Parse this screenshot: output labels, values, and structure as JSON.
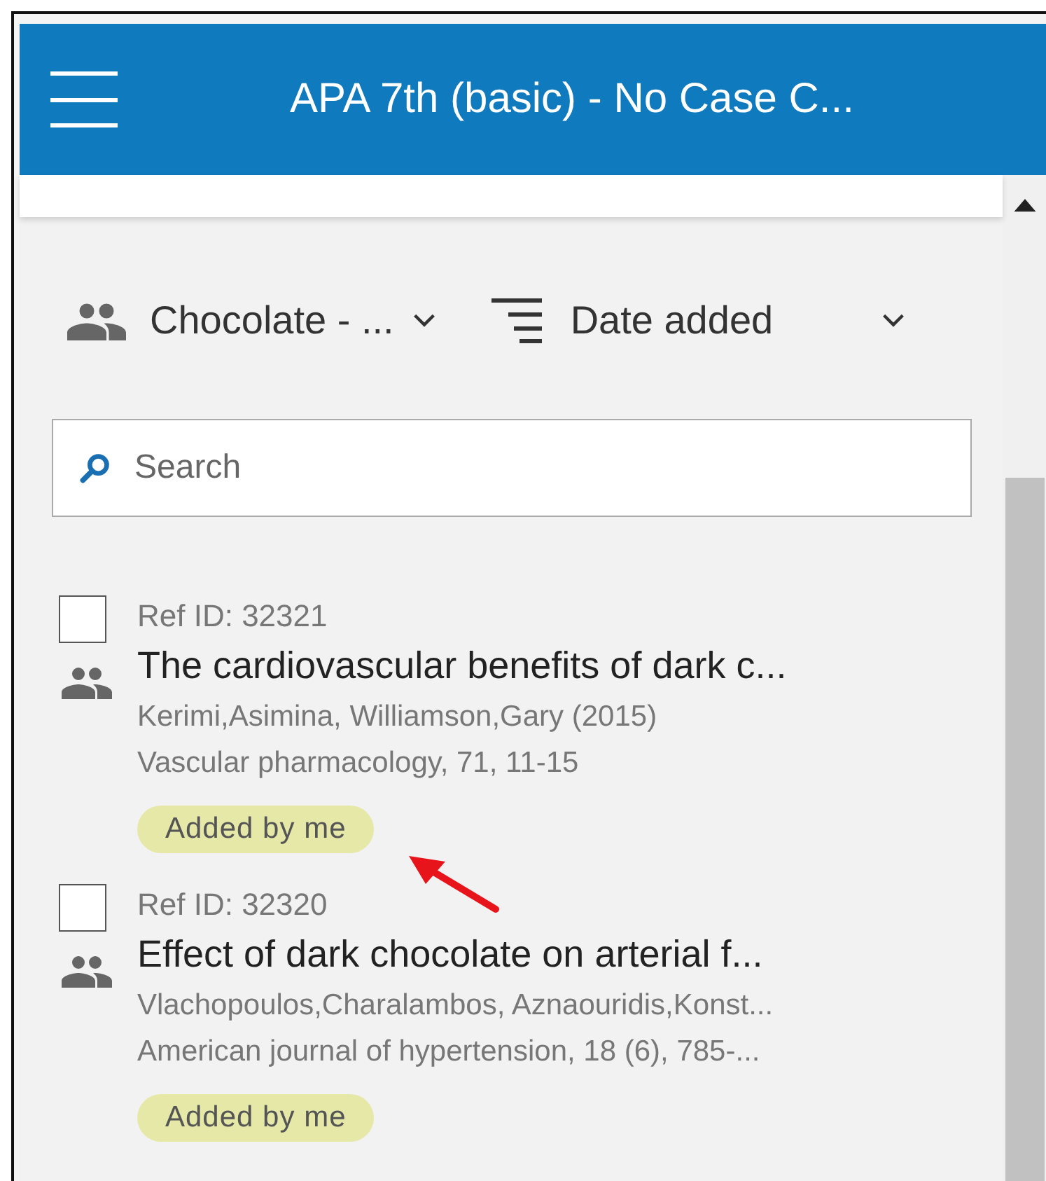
{
  "header": {
    "title": "APA 7th (basic) - No Case C..."
  },
  "toolbar": {
    "collection": "Chocolate - ...",
    "sort": "Date added"
  },
  "search": {
    "placeholder": "Search"
  },
  "references": [
    {
      "ref_id": "Ref ID: 32321",
      "title": "The cardiovascular benefits of dark c...",
      "authors": "Kerimi,Asimina, Williamson,Gary (2015)",
      "source": "Vascular pharmacology, 71, 11-15",
      "tag": "Added by me",
      "checked": false
    },
    {
      "ref_id": "Ref ID: 32320",
      "title": "Effect of dark chocolate on arterial f...",
      "authors": "Vlachopoulos,Charalambos, Aznaouridis,Konst...",
      "source": "American journal of hypertension, 18 (6), 785-...",
      "tag": "Added by me",
      "checked": false
    }
  ]
}
